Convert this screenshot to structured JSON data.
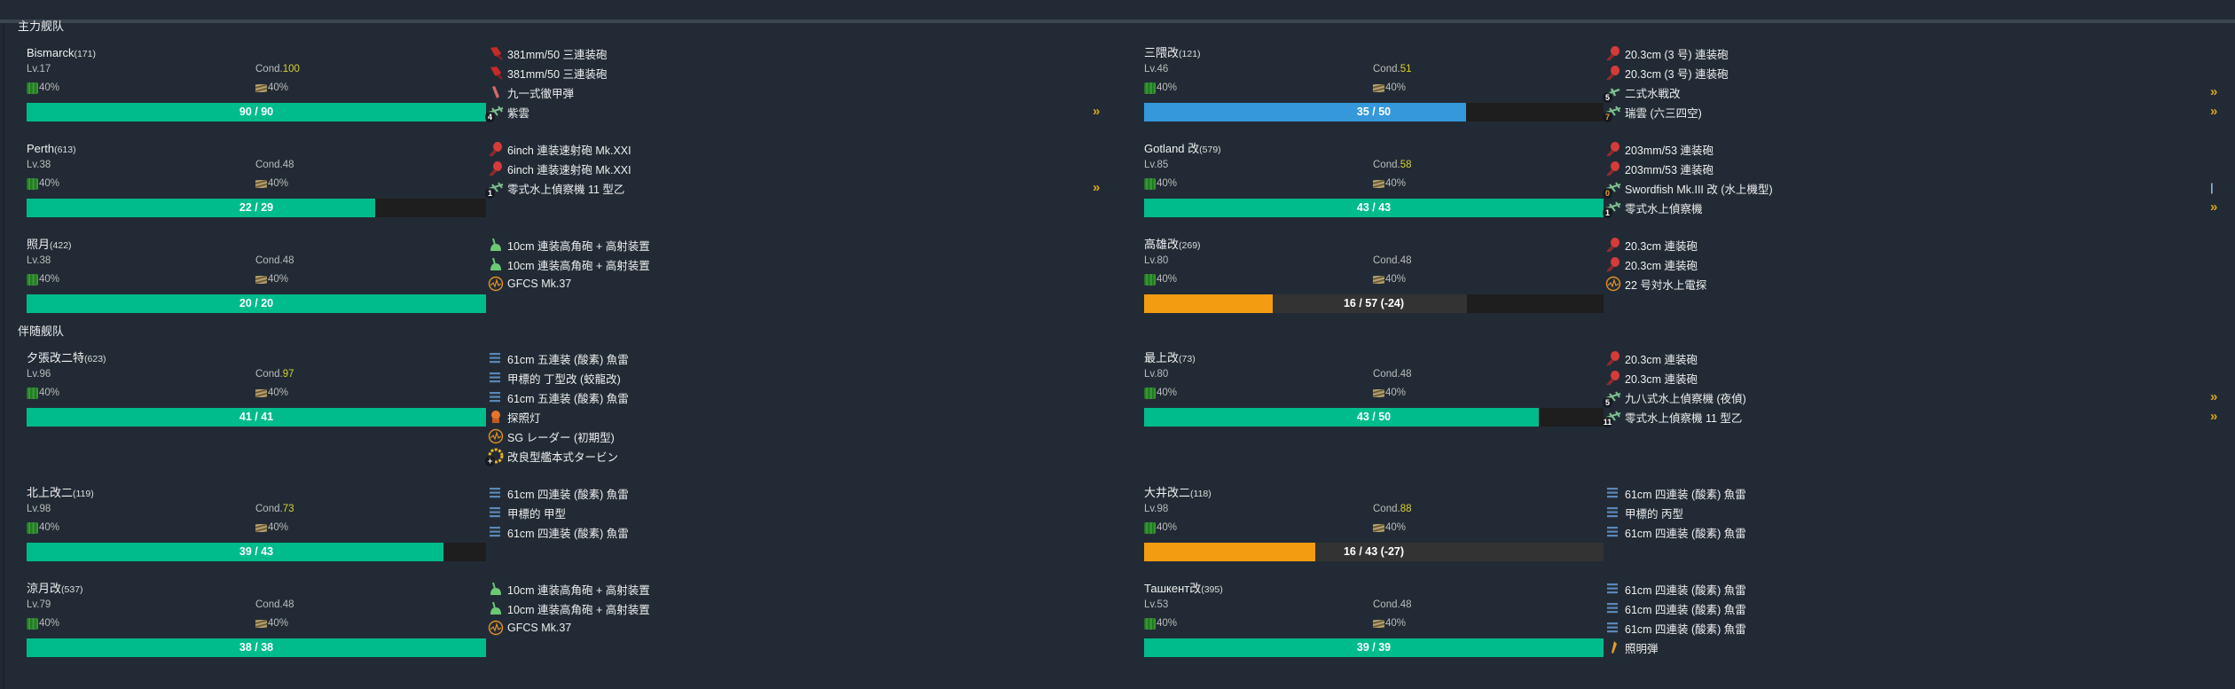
{
  "colors": {
    "green": "#00bc8c",
    "blue": "#3498db",
    "orange": "#f39c12",
    "empty": "#1e1e1e",
    "repair": "#333333",
    "cond_high": "#d7cf2e",
    "proficiency": "#d9a520"
  },
  "fleets": [
    {
      "title": "主力舰队",
      "rows": [
        [
          {
            "name": "Bismarck",
            "id": "(171)",
            "lv": "Lv.17",
            "cond_label": "Cond.",
            "cond": "100",
            "cond_high": true,
            "fuel": "40%",
            "ammo": "40%",
            "hp": 90,
            "hp_max": 90,
            "hp_text": "90 / 90",
            "bar_color": "green",
            "equips": [
              {
                "name": "381mm/50 三連装砲",
                "icon": "main-gun-icon"
              },
              {
                "name": "381mm/50 三連装砲",
                "icon": "main-gun-icon"
              },
              {
                "name": "九一式徹甲弾",
                "icon": "ap-shell-icon"
              },
              {
                "name": "紫雲",
                "icon": "seaplane-icon",
                "slot": "4",
                "prof": "»"
              }
            ]
          },
          {
            "name": "三隈改",
            "id": "(121)",
            "lv": "Lv.46",
            "cond_label": "Cond.",
            "cond": "51",
            "cond_high": true,
            "fuel": "40%",
            "ammo": "40%",
            "hp": 35,
            "hp_max": 50,
            "hp_text": "35 / 50",
            "bar_color": "blue",
            "equips": [
              {
                "name": "20.3cm (3 号) 連装砲",
                "icon": "medium-gun-icon"
              },
              {
                "name": "20.3cm (3 号) 連装砲",
                "icon": "medium-gun-icon"
              },
              {
                "name": "二式水戦改",
                "icon": "seaplane-fighter-icon",
                "slot": "5",
                "prof": "»"
              },
              {
                "name": "瑞雲 (六三四空)",
                "icon": "seaplane-icon",
                "slot": "7",
                "slot_warn": true,
                "prof": "»"
              }
            ]
          }
        ],
        [
          {
            "name": "Perth",
            "id": "(613)",
            "lv": "Lv.38",
            "cond_label": "Cond.",
            "cond": "48",
            "cond_high": false,
            "fuel": "40%",
            "ammo": "40%",
            "hp": 22,
            "hp_max": 29,
            "hp_text": "22 / 29",
            "bar_color": "green",
            "equips": [
              {
                "name": "6inch 連装速射砲 Mk.XXI",
                "icon": "medium-gun-icon"
              },
              {
                "name": "6inch 連装速射砲 Mk.XXI",
                "icon": "medium-gun-icon"
              },
              {
                "name": "零式水上偵察機 11 型乙",
                "icon": "seaplane-icon",
                "slot": "1",
                "prof": "»"
              }
            ]
          },
          {
            "name": "Gotland 改",
            "id": "(579)",
            "lv": "Lv.85",
            "cond_label": "Cond.",
            "cond": "58",
            "cond_high": true,
            "fuel": "40%",
            "ammo": "40%",
            "hp": 43,
            "hp_max": 43,
            "hp_text": "43 / 43",
            "bar_color": "green",
            "equips": [
              {
                "name": "203mm/53 連装砲",
                "icon": "medium-gun-icon"
              },
              {
                "name": "203mm/53 連装砲",
                "icon": "medium-gun-icon"
              },
              {
                "name": "Swordfish Mk.III 改 (水上機型)",
                "icon": "seaplane-icon",
                "slot": "0",
                "slot_warn": true,
                "prof": "|",
                "prof_blue": true
              },
              {
                "name": "零式水上偵察機",
                "icon": "seaplane-icon",
                "slot": "1",
                "prof": "»"
              }
            ]
          }
        ],
        [
          {
            "name": "照月",
            "id": "(422)",
            "lv": "Lv.38",
            "cond_label": "Cond.",
            "cond": "48",
            "cond_high": false,
            "fuel": "40%",
            "ammo": "40%",
            "hp": 20,
            "hp_max": 20,
            "hp_text": "20 / 20",
            "bar_color": "green",
            "equips": [
              {
                "name": "10cm 連装高角砲 + 高射装置",
                "icon": "aa-gun-icon"
              },
              {
                "name": "10cm 連装高角砲 + 高射装置",
                "icon": "aa-gun-icon"
              },
              {
                "name": "GFCS Mk.37",
                "icon": "radar-icon"
              }
            ]
          },
          {
            "name": "高雄改",
            "id": "(269)",
            "lv": "Lv.80",
            "cond_label": "Cond.",
            "cond": "48",
            "cond_high": false,
            "fuel": "40%",
            "ammo": "40%",
            "hp": 16,
            "hp_max": 57,
            "hp_repair": 24,
            "hp_text": "16 / 57 (-24)",
            "bar_color": "orange",
            "equips": [
              {
                "name": "20.3cm 連装砲",
                "icon": "medium-gun-icon"
              },
              {
                "name": "20.3cm 連装砲",
                "icon": "medium-gun-icon"
              },
              {
                "name": "22 号対水上電探",
                "icon": "radar-icon"
              }
            ]
          }
        ]
      ]
    },
    {
      "title": "伴随舰队",
      "rows": [
        [
          {
            "name": "夕張改二特",
            "id": "(623)",
            "lv": "Lv.96",
            "cond_label": "Cond.",
            "cond": "97",
            "cond_high": true,
            "fuel": "40%",
            "ammo": "40%",
            "hp": 41,
            "hp_max": 41,
            "hp_text": "41 / 41",
            "bar_color": "green",
            "equips": [
              {
                "name": "61cm 五連装 (酸素) 魚雷",
                "icon": "torpedo-icon"
              },
              {
                "name": "甲標的 丁型改 (蛟龍改)",
                "icon": "torpedo-icon"
              },
              {
                "name": "61cm 五連装 (酸素) 魚雷",
                "icon": "torpedo-icon"
              },
              {
                "name": "探照灯",
                "icon": "searchlight-icon"
              },
              {
                "name": "SG レーダー (初期型)",
                "icon": "radar-icon"
              },
              {
                "name": "改良型艦本式タービン",
                "icon": "turbine-icon",
                "slot": "+"
              }
            ]
          },
          {
            "name": "最上改",
            "id": "(73)",
            "lv": "Lv.80",
            "cond_label": "Cond.",
            "cond": "48",
            "cond_high": false,
            "fuel": "40%",
            "ammo": "40%",
            "hp": 43,
            "hp_max": 50,
            "hp_text": "43 / 50",
            "bar_color": "green",
            "equips": [
              {
                "name": "20.3cm 連装砲",
                "icon": "medium-gun-icon"
              },
              {
                "name": "20.3cm 連装砲",
                "icon": "medium-gun-icon"
              },
              {
                "name": "九八式水上偵察機 (夜偵)",
                "icon": "seaplane-icon",
                "slot": "5",
                "prof": "»"
              },
              {
                "name": "零式水上偵察機 11 型乙",
                "icon": "seaplane-icon",
                "slot": "11",
                "prof": "»"
              }
            ]
          }
        ],
        [
          {
            "name": "北上改二",
            "id": "(119)",
            "lv": "Lv.98",
            "cond_label": "Cond.",
            "cond": "73",
            "cond_high": true,
            "fuel": "40%",
            "ammo": "40%",
            "hp": 39,
            "hp_max": 43,
            "hp_text": "39 / 43",
            "bar_color": "green",
            "equips": [
              {
                "name": "61cm 四連装 (酸素) 魚雷",
                "icon": "torpedo-icon"
              },
              {
                "name": "甲標的 甲型",
                "icon": "torpedo-icon"
              },
              {
                "name": "61cm 四連装 (酸素) 魚雷",
                "icon": "torpedo-icon"
              }
            ]
          },
          {
            "name": "大井改二",
            "id": "(118)",
            "lv": "Lv.98",
            "cond_label": "Cond.",
            "cond": "88",
            "cond_high": true,
            "fuel": "40%",
            "ammo": "40%",
            "hp": 16,
            "hp_max": 43,
            "hp_repair": 27,
            "hp_text": "16 / 43 (-27)",
            "bar_color": "orange",
            "equips": [
              {
                "name": "61cm 四連装 (酸素) 魚雷",
                "icon": "torpedo-icon"
              },
              {
                "name": "甲標的 丙型",
                "icon": "torpedo-icon"
              },
              {
                "name": "61cm 四連装 (酸素) 魚雷",
                "icon": "torpedo-icon"
              }
            ]
          }
        ],
        [
          {
            "name": "涼月改",
            "id": "(537)",
            "lv": "Lv.79",
            "cond_label": "Cond.",
            "cond": "48",
            "cond_high": false,
            "fuel": "40%",
            "ammo": "40%",
            "hp": 38,
            "hp_max": 38,
            "hp_text": "38 / 38",
            "bar_color": "green",
            "equips": [
              {
                "name": "10cm 連装高角砲 + 高射装置",
                "icon": "aa-gun-icon"
              },
              {
                "name": "10cm 連装高角砲 + 高射装置",
                "icon": "aa-gun-icon"
              },
              {
                "name": "GFCS Mk.37",
                "icon": "radar-icon"
              }
            ]
          },
          {
            "name": "Ташкент改",
            "id": "(395)",
            "lv": "Lv.53",
            "cond_label": "Cond.",
            "cond": "48",
            "cond_high": false,
            "fuel": "40%",
            "ammo": "40%",
            "hp": 39,
            "hp_max": 39,
            "hp_text": "39 / 39",
            "bar_color": "green",
            "equips": [
              {
                "name": "61cm 四連装 (酸素) 魚雷",
                "icon": "torpedo-icon"
              },
              {
                "name": "61cm 四連装 (酸素) 魚雷",
                "icon": "torpedo-icon"
              },
              {
                "name": "61cm 四連装 (酸素) 魚雷",
                "icon": "torpedo-icon"
              },
              {
                "name": "照明弾",
                "icon": "star-shell-icon"
              }
            ]
          }
        ]
      ]
    }
  ]
}
